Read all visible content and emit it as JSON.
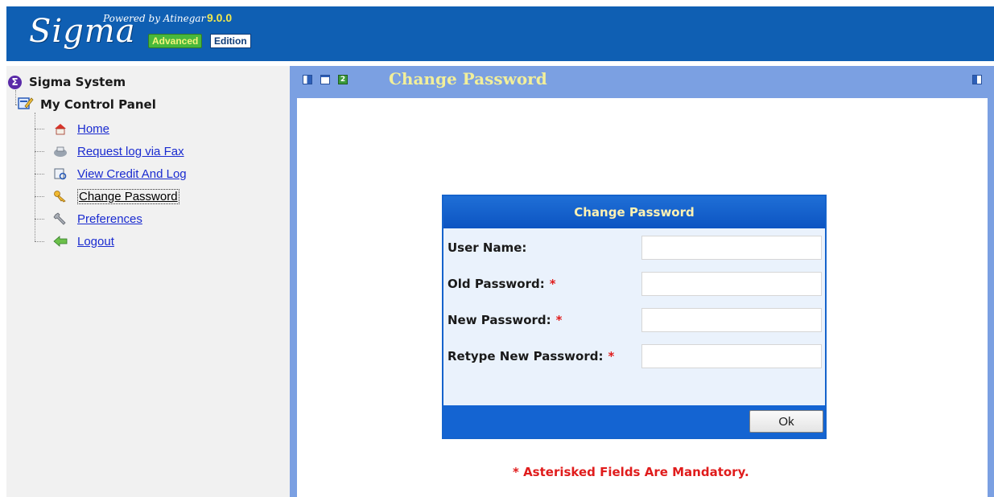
{
  "header": {
    "logo_word": "Sigma",
    "powered_by": "Powered by Atinegar",
    "version": "9.0.0",
    "badge_advanced": "Advanced",
    "badge_edition": "Edition"
  },
  "sidebar": {
    "root_label": "Sigma System",
    "panel_label": "My Control Panel",
    "items": [
      {
        "label": "Home",
        "icon": "home-icon"
      },
      {
        "label": "Request log via Fax",
        "icon": "fax-icon"
      },
      {
        "label": "View Credit And Log",
        "icon": "credit-log-icon"
      },
      {
        "label": "Change Password",
        "icon": "key-icon",
        "active": true
      },
      {
        "label": "Preferences",
        "icon": "wrench-icon"
      },
      {
        "label": "Logout",
        "icon": "arrow-left-icon"
      }
    ]
  },
  "main": {
    "title": "Change Password"
  },
  "dialog": {
    "title": "Change Password",
    "fields": [
      {
        "label": "User Name:",
        "required": false,
        "value": ""
      },
      {
        "label": "Old Password:",
        "required": true,
        "value": ""
      },
      {
        "label": "New Password:",
        "required": true,
        "value": ""
      },
      {
        "label": "Retype New Password:",
        "required": true,
        "value": ""
      }
    ],
    "required_mark": "*",
    "ok_label": "Ok"
  },
  "note": "* Asterisked Fields Are Mandatory.",
  "colors": {
    "header_bg": "#0f5fb3",
    "panel_bg": "#7ba0e2",
    "dialog_accent": "#1464d2",
    "link": "#1a2bd0",
    "required": "#e01c1c"
  }
}
